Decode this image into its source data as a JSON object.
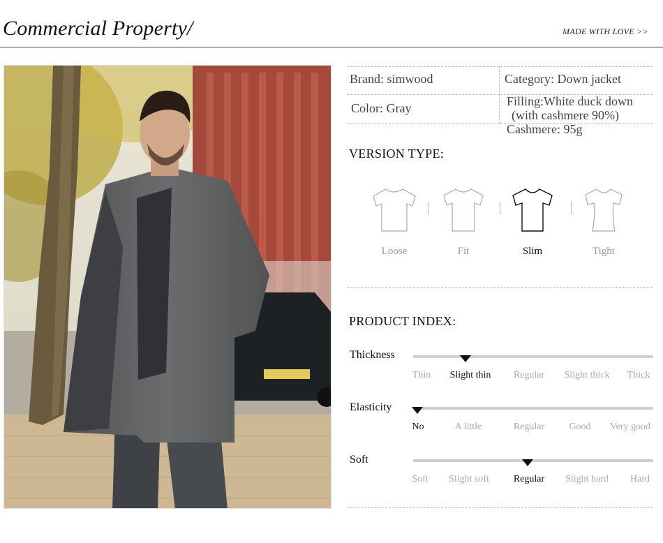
{
  "header": {
    "title": "Commercial Property/",
    "tagline": "MADE WITH LOVE >>"
  },
  "specs": {
    "brand": "Brand:  simwood",
    "category": "Category:  Down jacket",
    "color": "Color:  Gray",
    "filling_line1": "Filling:White duck down",
    "filling_line2": "(with cashmere 90%)",
    "cashmere": "Cashmere: 95g"
  },
  "version": {
    "title": "VERSION TYPE:",
    "options": [
      "Loose",
      "Fit",
      "Slim",
      "Tight"
    ],
    "selected": "Slim"
  },
  "product_index": {
    "title": "PRODUCT INDEX:",
    "rows": [
      {
        "name": "Thickness",
        "options": [
          "Thin",
          "Slight thin",
          "Regular",
          "Slight thick",
          "Thick"
        ],
        "selected": "Slight thin"
      },
      {
        "name": "Elasticity",
        "options": [
          "No",
          "A little",
          "Regular",
          "Good",
          "Very good"
        ],
        "selected": "No"
      },
      {
        "name": "Soft",
        "options": [
          "Soft",
          "Slight soft",
          "Regular",
          "Slight hard",
          "Hard"
        ],
        "selected": "Regular"
      }
    ]
  },
  "colors": {
    "jacket": "#5f6163",
    "brick": "#a5493d",
    "foliage": "#c8b13c",
    "marker": "#111111"
  },
  "icons": [
    "tshirt-loose-icon",
    "tshirt-fit-icon",
    "tshirt-slim-icon",
    "tshirt-tight-icon",
    "triangle-marker-icon"
  ]
}
